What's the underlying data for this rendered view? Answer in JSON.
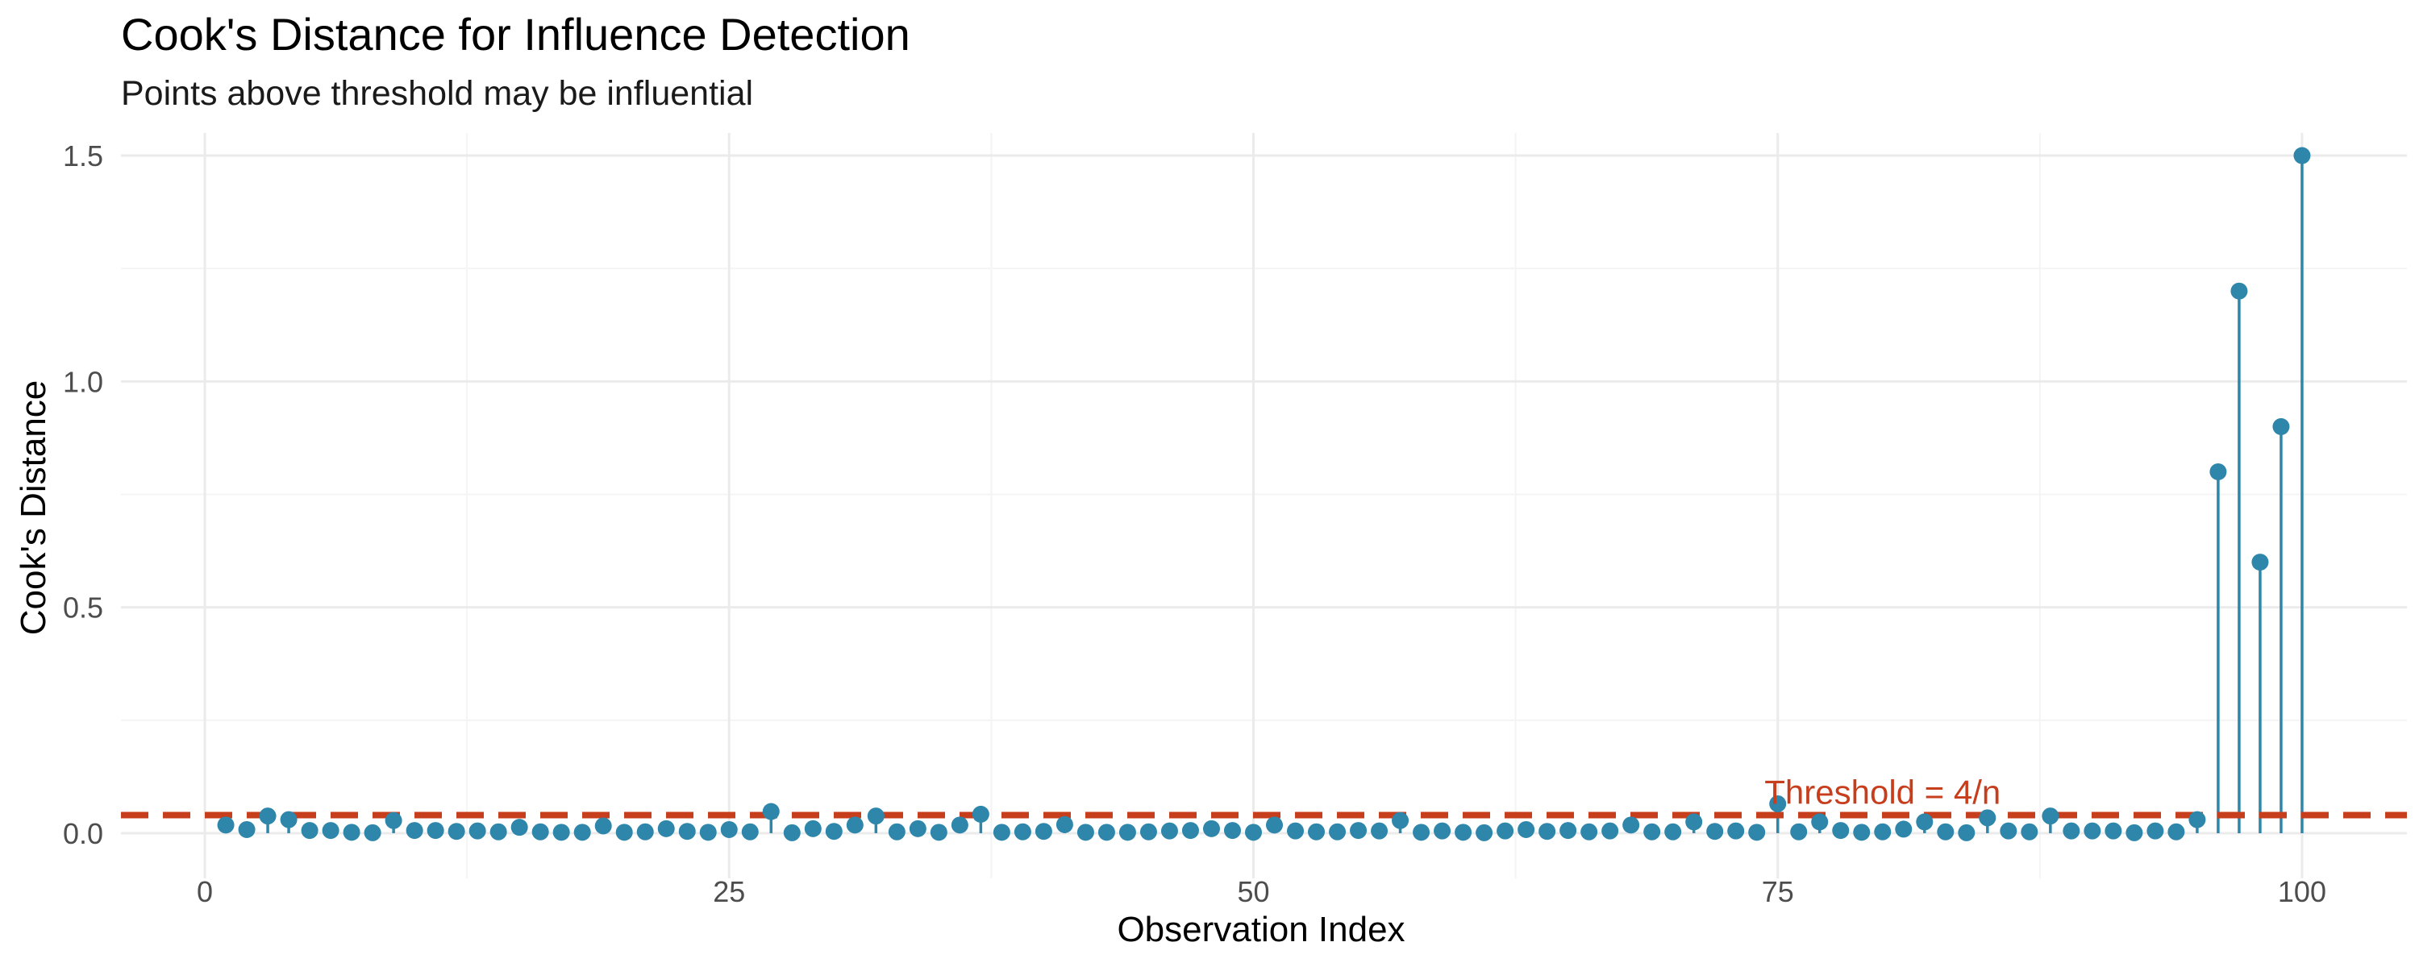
{
  "colors": {
    "point": "#2e86ab",
    "threshold": "#c73e1d",
    "grid_major": "#ebebeb",
    "grid_minor": "#f4f4f4"
  },
  "chart_data": {
    "type": "scatter",
    "style": "lollipop",
    "title": "Cook's Distance for Influence Detection",
    "subtitle": "Points above threshold may be influential",
    "xlabel": "Observation Index",
    "ylabel": "Cook's Distance",
    "xlim": [
      -4,
      105
    ],
    "ylim": [
      -0.1,
      1.55
    ],
    "x_ticks": [
      0,
      25,
      50,
      75,
      100
    ],
    "x_tick_labels": [
      "0",
      "25",
      "50",
      "75",
      "100"
    ],
    "y_ticks": [
      0,
      0.5,
      1.0,
      1.5
    ],
    "y_tick_labels": [
      "0.0",
      "0.5",
      "1.0",
      "1.5"
    ],
    "grid": true,
    "threshold": {
      "value": 0.04,
      "label": "Threshold = 4/n",
      "label_x": 80
    },
    "x": [
      1,
      2,
      3,
      4,
      5,
      6,
      7,
      8,
      9,
      10,
      11,
      12,
      13,
      14,
      15,
      16,
      17,
      18,
      19,
      20,
      21,
      22,
      23,
      24,
      25,
      26,
      27,
      28,
      29,
      30,
      31,
      32,
      33,
      34,
      35,
      36,
      37,
      38,
      39,
      40,
      41,
      42,
      43,
      44,
      45,
      46,
      47,
      48,
      49,
      50,
      51,
      52,
      53,
      54,
      55,
      56,
      57,
      58,
      59,
      60,
      61,
      62,
      63,
      64,
      65,
      66,
      67,
      68,
      69,
      70,
      71,
      72,
      73,
      74,
      75,
      76,
      77,
      78,
      79,
      80,
      81,
      82,
      83,
      84,
      85,
      86,
      87,
      88,
      89,
      90,
      91,
      92,
      93,
      94,
      95,
      96,
      97,
      98,
      99,
      100
    ],
    "values": [
      0.018,
      0.008,
      0.038,
      0.03,
      0.006,
      0.006,
      0.002,
      0.001,
      0.028,
      0.006,
      0.006,
      0.004,
      0.005,
      0.003,
      0.013,
      0.003,
      0.002,
      0.002,
      0.016,
      0.002,
      0.003,
      0.01,
      0.004,
      0.002,
      0.008,
      0.003,
      0.048,
      0.001,
      0.01,
      0.004,
      0.018,
      0.038,
      0.003,
      0.01,
      0.002,
      0.018,
      0.042,
      0.002,
      0.003,
      0.004,
      0.019,
      0.002,
      0.002,
      0.002,
      0.003,
      0.005,
      0.006,
      0.01,
      0.006,
      0.002,
      0.018,
      0.005,
      0.003,
      0.003,
      0.006,
      0.005,
      0.028,
      0.002,
      0.005,
      0.002,
      0.001,
      0.005,
      0.008,
      0.004,
      0.006,
      0.003,
      0.005,
      0.018,
      0.003,
      0.003,
      0.025,
      0.004,
      0.005,
      0.002,
      0.065,
      0.003,
      0.025,
      0.006,
      0.002,
      0.003,
      0.009,
      0.025,
      0.003,
      0.001,
      0.034,
      0.005,
      0.003,
      0.038,
      0.005,
      0.005,
      0.005,
      0.001,
      0.005,
      0.003,
      0.03,
      0.8,
      1.2,
      0.6,
      0.9,
      1.5
    ]
  }
}
